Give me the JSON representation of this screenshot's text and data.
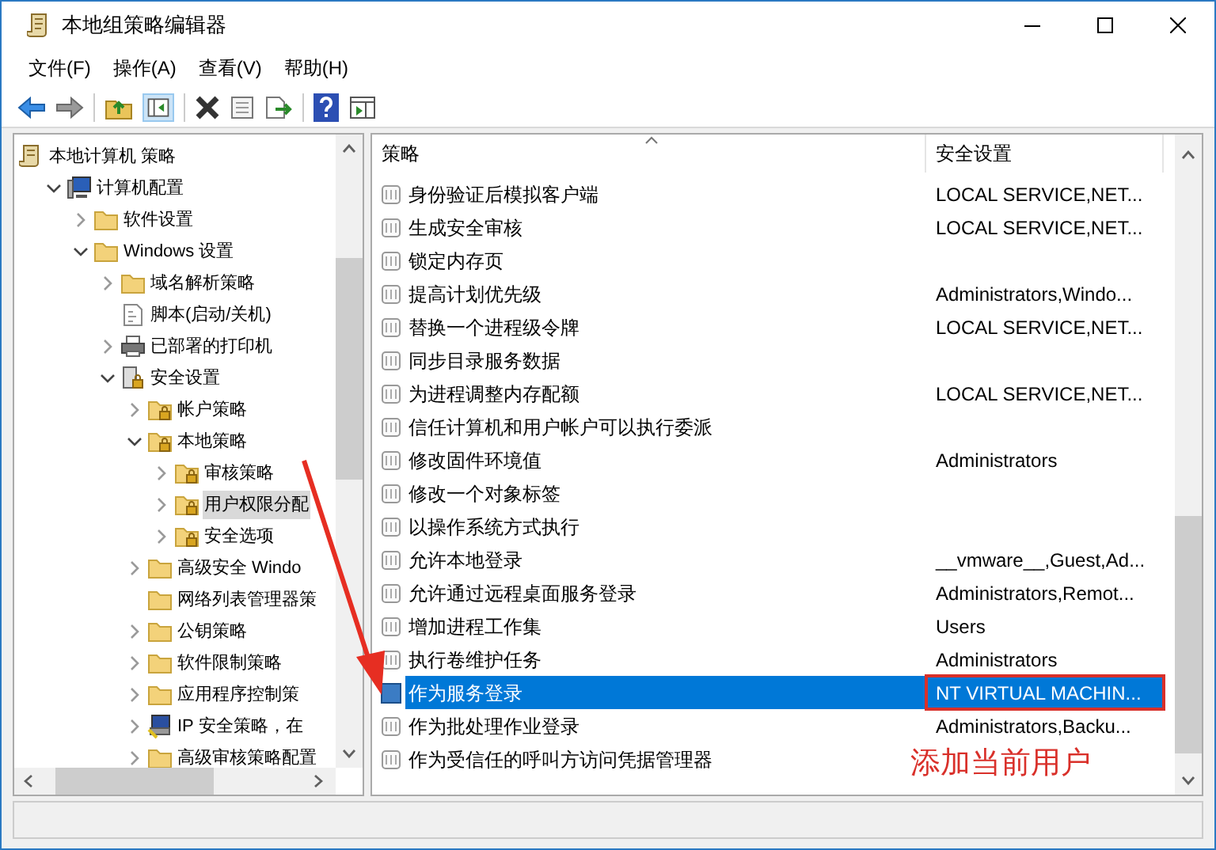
{
  "window": {
    "title": "本地组策略编辑器"
  },
  "menu": [
    "文件(F)",
    "操作(A)",
    "查看(V)",
    "帮助(H)"
  ],
  "tree": [
    {
      "label": "本地计算机 策略",
      "kind": "scroll",
      "selected": false,
      "children": [
        {
          "label": "计算机配置",
          "kind": "computer",
          "expanded": true,
          "selected": false,
          "children": [
            {
              "label": "软件设置",
              "kind": "folder",
              "expanded": false,
              "selected": false
            },
            {
              "label": "Windows 设置",
              "kind": "folder",
              "expanded": true,
              "selected": false,
              "children": [
                {
                  "label": "域名解析策略",
                  "kind": "folder",
                  "expanded": false,
                  "selected": false
                },
                {
                  "label": "脚本(启动/关机)",
                  "kind": "script",
                  "selected": false
                },
                {
                  "label": "已部署的打印机",
                  "kind": "printer",
                  "expanded": false,
                  "selected": false
                },
                {
                  "label": "安全设置",
                  "kind": "secure",
                  "expanded": true,
                  "selected": false,
                  "children": [
                    {
                      "label": "帐户策略",
                      "kind": "lockfolder",
                      "expanded": false,
                      "selected": false
                    },
                    {
                      "label": "本地策略",
                      "kind": "lockfolder",
                      "expanded": true,
                      "selected": false,
                      "children": [
                        {
                          "label": "审核策略",
                          "kind": "lockfolder",
                          "expanded": false,
                          "selected": false
                        },
                        {
                          "label": "用户权限分配",
                          "kind": "lockfolder",
                          "expanded": false,
                          "selected": true
                        },
                        {
                          "label": "安全选项",
                          "kind": "lockfolder",
                          "expanded": false,
                          "selected": false
                        }
                      ]
                    },
                    {
                      "label": "高级安全 Windo",
                      "kind": "folder",
                      "expanded": false,
                      "selected": false
                    },
                    {
                      "label": "网络列表管理器策",
                      "kind": "folder",
                      "selected": false
                    },
                    {
                      "label": "公钥策略",
                      "kind": "folder",
                      "expanded": false,
                      "selected": false
                    },
                    {
                      "label": "软件限制策略",
                      "kind": "folder",
                      "expanded": false,
                      "selected": false
                    },
                    {
                      "label": "应用程序控制策",
                      "kind": "folder",
                      "expanded": false,
                      "selected": false
                    },
                    {
                      "label": "IP 安全策略，在",
                      "kind": "ipsec",
                      "expanded": false,
                      "selected": false
                    },
                    {
                      "label": "高级审核策略配置",
                      "kind": "folder",
                      "expanded": false,
                      "selected": false
                    }
                  ]
                }
              ]
            }
          ]
        }
      ]
    }
  ],
  "table": {
    "columns": [
      "策略",
      "安全设置"
    ],
    "rows": [
      {
        "policy": "身份验证后模拟客户端",
        "setting": "LOCAL SERVICE,NET...",
        "selected": false,
        "highlighted": false
      },
      {
        "policy": "生成安全审核",
        "setting": "LOCAL SERVICE,NET...",
        "selected": false,
        "highlighted": false
      },
      {
        "policy": "锁定内存页",
        "selected": false,
        "highlighted": false
      },
      {
        "policy": "提高计划优先级",
        "setting": "Administrators,Windo...",
        "selected": false,
        "highlighted": false
      },
      {
        "policy": "替换一个进程级令牌",
        "setting": "LOCAL SERVICE,NET...",
        "selected": false,
        "highlighted": false
      },
      {
        "policy": "同步目录服务数据",
        "selected": false,
        "highlighted": false
      },
      {
        "policy": "为进程调整内存配额",
        "setting": "LOCAL SERVICE,NET...",
        "selected": false,
        "highlighted": false
      },
      {
        "policy": "信任计算机和用户帐户可以执行委派",
        "selected": false,
        "highlighted": false
      },
      {
        "policy": "修改固件环境值",
        "setting": "Administrators",
        "selected": false,
        "highlighted": false
      },
      {
        "policy": "修改一个对象标签",
        "selected": false,
        "highlighted": false
      },
      {
        "policy": "以操作系统方式执行",
        "selected": false,
        "highlighted": false
      },
      {
        "policy": "允许本地登录",
        "setting": "__vmware__,Guest,Ad...",
        "selected": false,
        "highlighted": false
      },
      {
        "policy": "允许通过远程桌面服务登录",
        "setting": "Administrators,Remot...",
        "selected": false,
        "highlighted": false
      },
      {
        "policy": "增加进程工作集",
        "setting": "Users",
        "selected": false,
        "highlighted": false
      },
      {
        "policy": "执行卷维护任务",
        "setting": "Administrators",
        "selected": false,
        "highlighted": false
      },
      {
        "policy": "作为服务登录",
        "setting": "NT VIRTUAL MACHIN...",
        "selected": true,
        "highlighted": true
      },
      {
        "policy": "作为批处理作业登录",
        "setting": "Administrators,Backu...",
        "selected": false,
        "highlighted": false
      },
      {
        "policy": "作为受信任的呼叫方访问凭据管理器",
        "selected": false,
        "highlighted": false
      }
    ]
  },
  "annotation": {
    "text": "添加当前用户"
  }
}
